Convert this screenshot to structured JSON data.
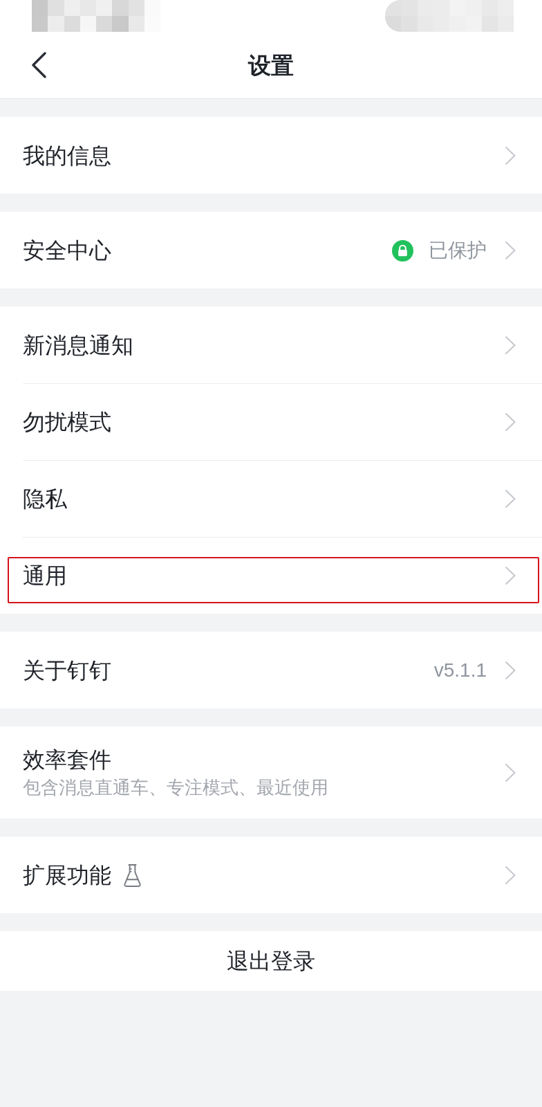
{
  "header": {
    "title": "设置"
  },
  "sections": [
    {
      "items": [
        {
          "kind": "plain",
          "label": "我的信息",
          "highlighted": false
        }
      ]
    },
    {
      "items": [
        {
          "kind": "status",
          "label": "安全中心",
          "value": "已保护",
          "highlighted": false
        }
      ]
    },
    {
      "items": [
        {
          "kind": "plain",
          "label": "新消息通知",
          "highlighted": false
        },
        {
          "kind": "plain",
          "label": "勿扰模式",
          "highlighted": false
        },
        {
          "kind": "plain",
          "label": "隐私",
          "highlighted": false
        },
        {
          "kind": "plain",
          "label": "通用",
          "highlighted": true
        }
      ]
    },
    {
      "items": [
        {
          "kind": "version",
          "label": "关于钉钉",
          "value": "v5.1.1",
          "highlighted": false
        }
      ]
    },
    {
      "items": [
        {
          "kind": "described",
          "label": "效率套件",
          "subtitle": "包含消息直通车、专注模式、最近使用",
          "highlighted": false
        }
      ]
    },
    {
      "items": [
        {
          "kind": "lab",
          "label": "扩展功能",
          "highlighted": false
        }
      ]
    }
  ],
  "logout": {
    "label": "退出登录"
  }
}
